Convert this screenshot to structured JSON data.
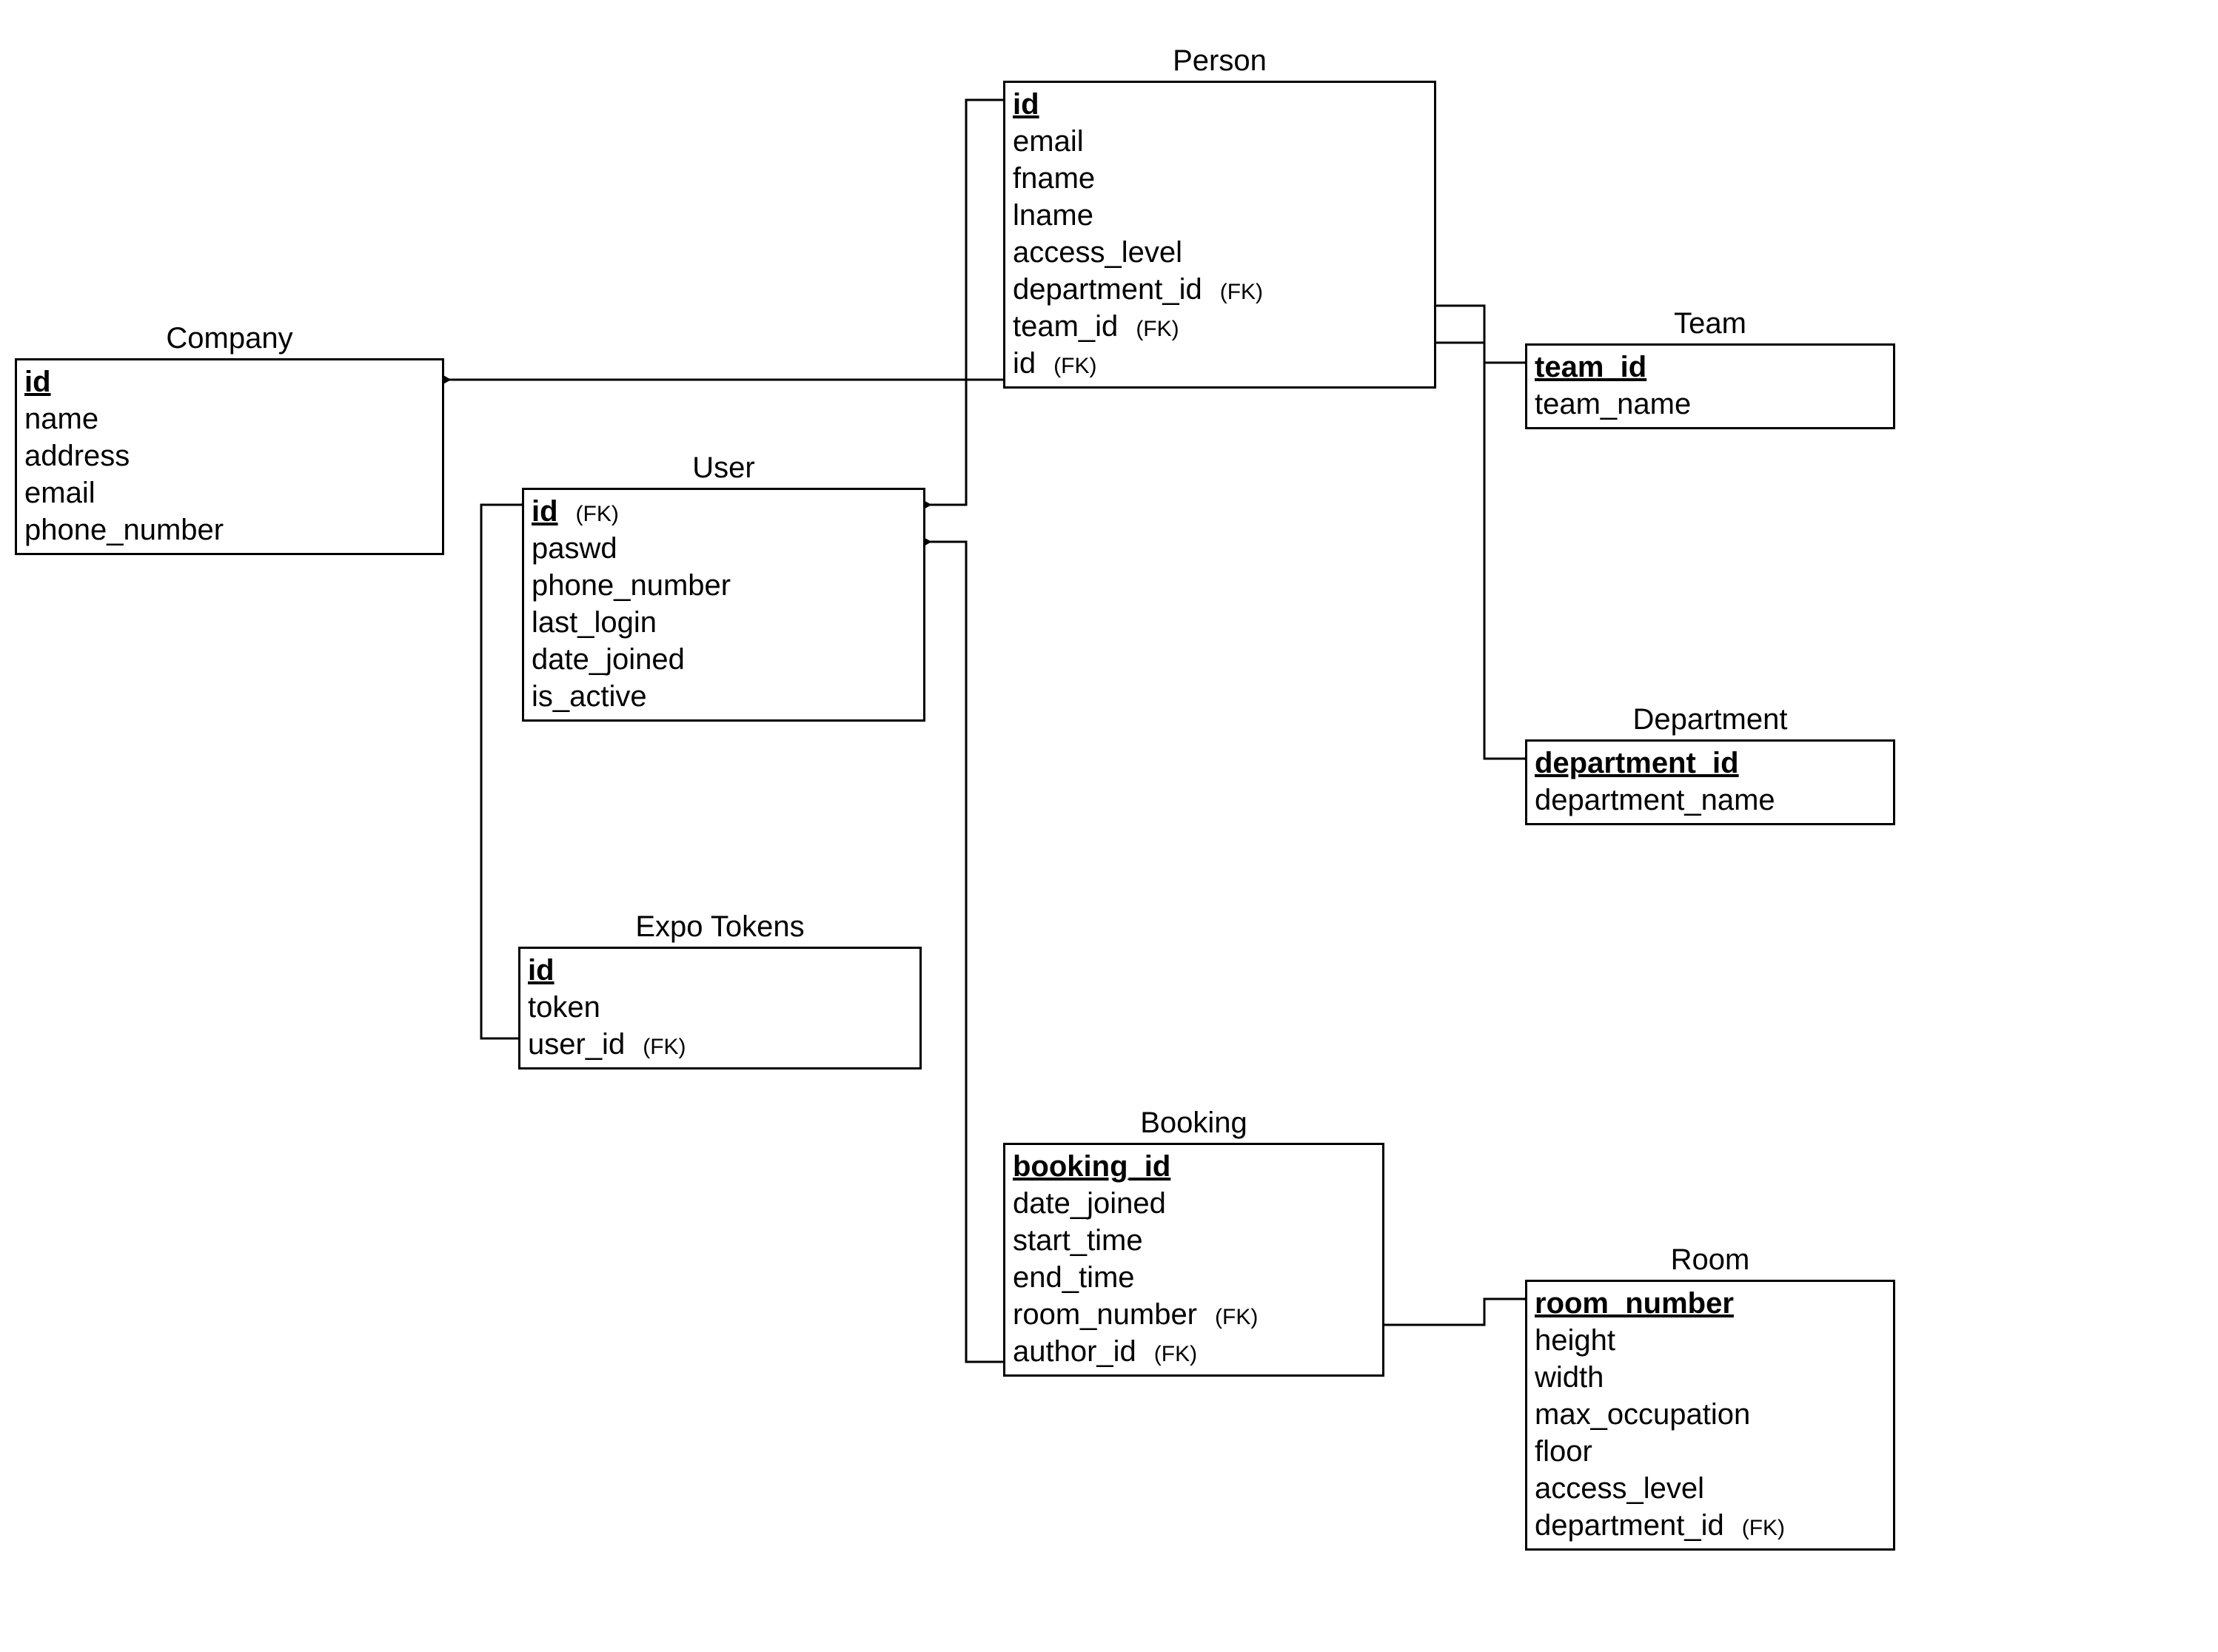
{
  "fk_label": "(FK)",
  "entities": {
    "company": {
      "title": "Company",
      "attrs": [
        {
          "name": "id",
          "pk": true
        },
        {
          "name": "name"
        },
        {
          "name": "address"
        },
        {
          "name": "email"
        },
        {
          "name": "phone_number"
        }
      ]
    },
    "person": {
      "title": "Person",
      "attrs": [
        {
          "name": "id",
          "pk": true
        },
        {
          "name": "email"
        },
        {
          "name": "fname"
        },
        {
          "name": "lname"
        },
        {
          "name": "access_level"
        },
        {
          "name": "department_id",
          "fk": true
        },
        {
          "name": "team_id",
          "fk": true
        },
        {
          "name": "id",
          "fk": true
        }
      ]
    },
    "user": {
      "title": "User",
      "attrs": [
        {
          "name": "id",
          "pk": true,
          "fk": true
        },
        {
          "name": "paswd"
        },
        {
          "name": "phone_number"
        },
        {
          "name": "last_login"
        },
        {
          "name": "date_joined"
        },
        {
          "name": "is_active"
        }
      ]
    },
    "team": {
      "title": "Team",
      "attrs": [
        {
          "name": "team_id",
          "pk": true
        },
        {
          "name": "team_name"
        }
      ]
    },
    "department": {
      "title": "Department",
      "attrs": [
        {
          "name": "department_id",
          "pk": true
        },
        {
          "name": "department_name"
        }
      ]
    },
    "expo_tokens": {
      "title": "Expo Tokens",
      "attrs": [
        {
          "name": "id",
          "pk": true
        },
        {
          "name": "token"
        },
        {
          "name": "user_id",
          "fk": true
        }
      ]
    },
    "booking": {
      "title": "Booking",
      "attrs": [
        {
          "name": "booking_id",
          "pk": true
        },
        {
          "name": "date_joined"
        },
        {
          "name": "start_time"
        },
        {
          "name": "end_time"
        },
        {
          "name": "room_number",
          "fk": true
        },
        {
          "name": "author_id",
          "fk": true
        }
      ]
    },
    "room": {
      "title": "Room",
      "attrs": [
        {
          "name": "room_number",
          "pk": true
        },
        {
          "name": "height"
        },
        {
          "name": "width"
        },
        {
          "name": "max_occupation"
        },
        {
          "name": "floor"
        },
        {
          "name": "access_level"
        },
        {
          "name": "department_id",
          "fk": true
        }
      ]
    }
  },
  "relationships": [
    {
      "from": "Person.id (FK)",
      "to": "Company.id"
    },
    {
      "from": "Person.id (FK, row id)",
      "to": "User.id"
    },
    {
      "from": "Person.team_id",
      "to": "Team.team_id"
    },
    {
      "from": "Person.department_id",
      "to": "Department.department_id"
    },
    {
      "from": "ExpoTokens.user_id",
      "to": "User.id"
    },
    {
      "from": "Booking.author_id",
      "to": "User.id"
    },
    {
      "from": "Booking.room_number",
      "to": "Room.room_number"
    }
  ]
}
